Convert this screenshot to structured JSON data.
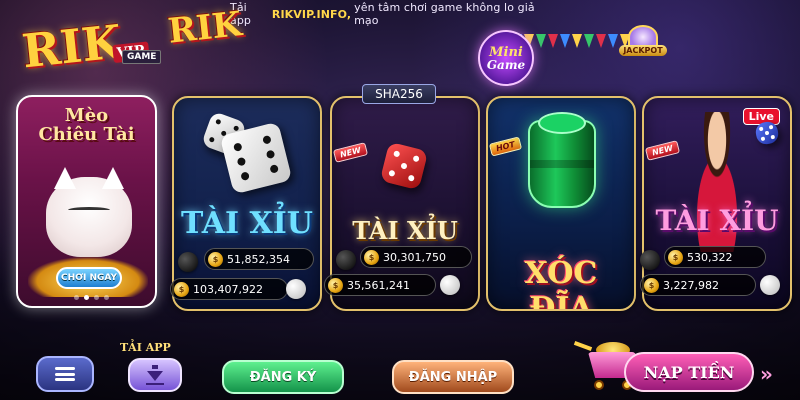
{
  "banner": {
    "prefix": "Tải app",
    "site": "RIKVIP.INFO,",
    "suffix": "yên tâm chơi game không lo giả mạo"
  },
  "logos": {
    "main": "RIK",
    "main_badge": "VIP",
    "secondary": "RIK",
    "game_tag": "GAME",
    "mini_game_line1": "Mini",
    "mini_game_line2": "Game",
    "jackpot": "JACKPOT"
  },
  "cards": [
    {
      "id": "meo-chieu-tai",
      "title_line1": "Mèo",
      "title_line2": "Chiêu Tài",
      "cta": "CHƠI NGAY",
      "dots": 4,
      "active_dot": 1
    },
    {
      "id": "tai-xiu-1",
      "title": "TÀI XỈU",
      "stat_top": "51,852,354",
      "stat_bottom": "103,407,922"
    },
    {
      "id": "tai-xiu-sha256",
      "tag": "SHA256",
      "badge": "NEW",
      "title": "TÀI XỈU",
      "stat_top": "30,301,750",
      "stat_bottom": "35,561,241"
    },
    {
      "id": "xoc-dia",
      "badge": "HOT",
      "title": "XÓC ĐĨA"
    },
    {
      "id": "tai-xiu-live",
      "badge": "NEW",
      "live": "Live",
      "title": "TÀI XỈU",
      "stat_top": "530,322",
      "stat_bottom": "3,227,982"
    }
  ],
  "bottom_bar": {
    "app_label": "TẢI APP",
    "register": "ĐĂNG KÝ",
    "login": "ĐĂNG NHẬP",
    "topup": "NẠP TIỀN",
    "chevrons": "»"
  },
  "icons": {
    "menu": "menu-icon",
    "download": "download-icon",
    "cart": "cart-icon",
    "coin": "coin-icon"
  },
  "colors": {
    "accent_gold": "#ffd74a",
    "register_green": "#14934a",
    "login_orange": "#a04a1d",
    "topup_pink": "#ff5fb7"
  }
}
